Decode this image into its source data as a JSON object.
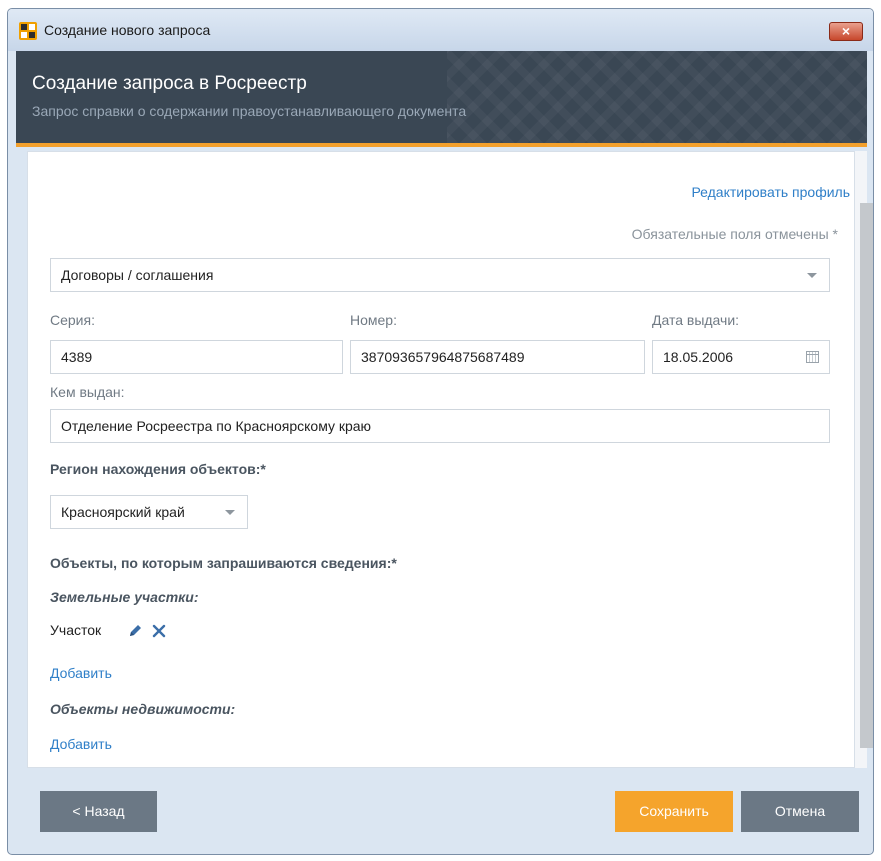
{
  "window": {
    "title": "Создание нового запроса",
    "close_label": "×"
  },
  "header": {
    "title": "Создание запроса в Росреестр",
    "subtitle": "Запрос справки о содержании правоустанавливающего документа"
  },
  "form": {
    "edit_profile_link": "Редактировать профиль",
    "required_note": "Обязательные поля отмечены *",
    "doc_type": {
      "value": "Договоры / соглашения"
    },
    "series": {
      "label": "Серия:",
      "value": "4389"
    },
    "number": {
      "label": "Номер:",
      "value": "387093657964875687489"
    },
    "issue_date": {
      "label": "Дата выдачи:",
      "value": "18.05.2006"
    },
    "issued_by": {
      "label": "Кем выдан:",
      "value": "Отделение Росреестра по Красноярскому краю"
    },
    "region": {
      "label": "Регион нахождения объектов:*",
      "value": "Красноярский край"
    },
    "objects": {
      "label": "Объекты, по которым запрашиваются сведения:*",
      "land_plots_label": "Земельные участки:",
      "land_plot_item": "Участок",
      "add_land_link": "Добавить",
      "real_estate_label": "Объекты недвижимости:",
      "add_real_estate_link": "Добавить"
    }
  },
  "buttons": {
    "back": "< Назад",
    "save": "Сохранить",
    "cancel": "Отмена"
  },
  "colors": {
    "header_bg": "#3a4754",
    "accent_orange": "#f5a42c",
    "link_blue": "#2f7fc8",
    "button_gray": "#6b7885"
  }
}
